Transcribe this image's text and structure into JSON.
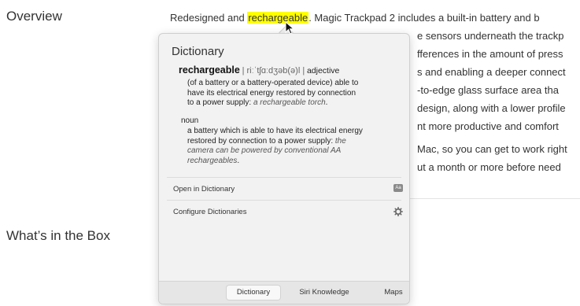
{
  "sections": {
    "overview": "Overview",
    "in_box": "What’s in the Box"
  },
  "article": {
    "line1_before": "Redesigned and ",
    "line1_highlight": "rechargeable",
    "line1_after": ". Magic Trackpad 2 includes a built-in battery and b",
    "line2": "e sensors underneath the trackp",
    "line3": "fferences in the amount of press",
    "line4": "s and enabling a deeper connect",
    "line5": "-to-edge glass surface area tha",
    "line6": "design, along with a lower profile",
    "line7": "nt more productive and comfort",
    "line8": "Mac, so you can get to work right",
    "line9": "ut a month or more before need"
  },
  "popover": {
    "title": "Dictionary",
    "headword": "rechargeable",
    "pronunciation": "| riːˈtʃɑːdʒəb(ə)l |",
    "pos_adjective": "adjective",
    "adj_def_1": "(of a battery or a battery-operated device) able to",
    "adj_def_2": "have its electrical energy restored by connection",
    "adj_def_3": "to a power supply: ",
    "adj_example": "a rechargeable torch",
    "adj_def_end": ".",
    "pos_noun": "noun",
    "noun_def_1": "a battery which is able to have its electrical energy",
    "noun_def_2": "restored by connection to a power supply: ",
    "noun_example_1": "the",
    "noun_example_2": "camera can be powered by conventional AA",
    "noun_example_3": "rechargeables",
    "noun_def_end": ".",
    "open_label": "Open in Dictionary",
    "configure_label": "Configure Dictionaries",
    "tabs": [
      "Dictionary",
      "Siri Knowledge",
      "Maps"
    ],
    "active_tab": "Dictionary",
    "book_icon_text": "Aa"
  },
  "colors": {
    "highlight": "#ffff00",
    "popover_bg": "#f2f2f2"
  }
}
